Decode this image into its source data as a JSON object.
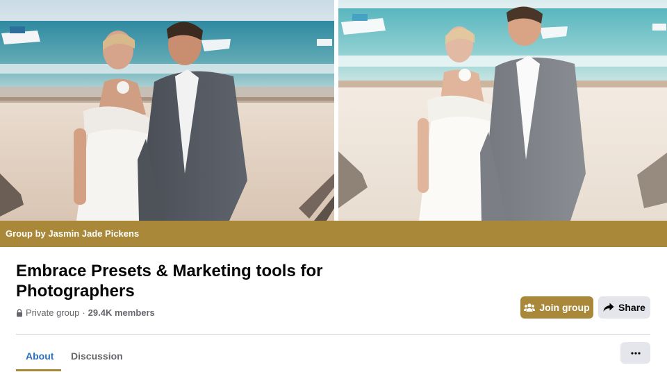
{
  "cover": {
    "group_by": "Group by Jasmin Jade Pickens",
    "bar_color": "#a9883a"
  },
  "group": {
    "name": "Embrace Presets & Marketing tools for Photographers",
    "privacy": "Private group",
    "separator": "·",
    "members": "29.4K members"
  },
  "actions": {
    "join_label": "Join group",
    "share_label": "Share",
    "join_icon": "people-icon",
    "share_icon": "share-arrow-icon"
  },
  "tabs": [
    {
      "label": "About",
      "active": true
    },
    {
      "label": "Discussion",
      "active": false
    }
  ],
  "more": {
    "icon": "more-dots-icon"
  }
}
